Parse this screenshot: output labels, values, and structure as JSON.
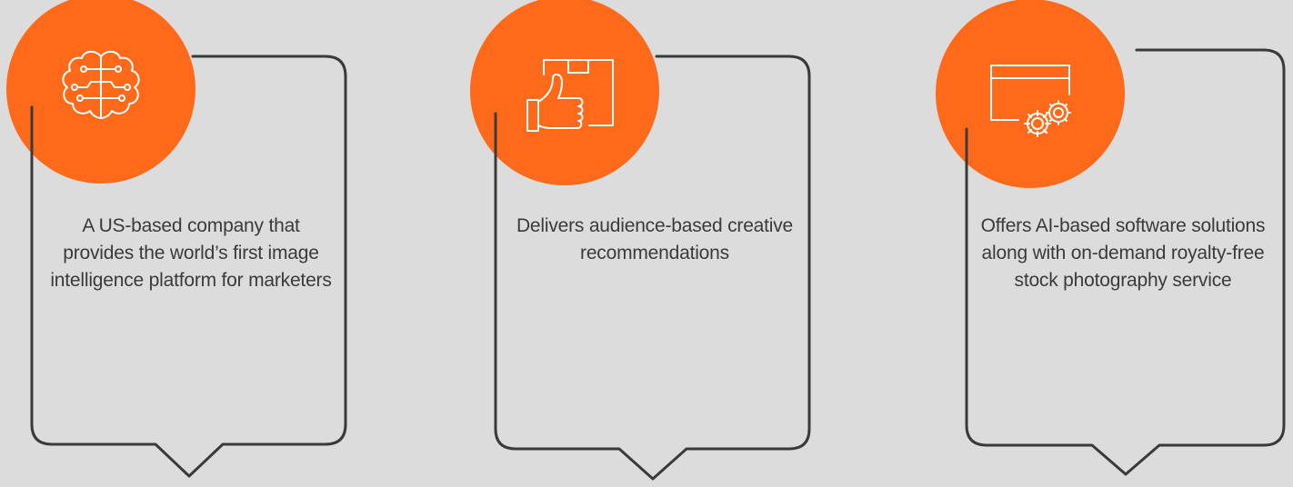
{
  "colors": {
    "background": "#DCDCDC",
    "accent": "#FF6A1A",
    "outline": "#3A3A3A",
    "text": "#3A3A3A",
    "icon": "#FFFFFF"
  },
  "cards": [
    {
      "icon": "brain-circuit-icon",
      "text": "A US-based company that provides the world’s first image intelligence platform for marketers"
    },
    {
      "icon": "thumbs-up-box-icon",
      "text": "Delivers audience-based creative recommendations"
    },
    {
      "icon": "window-gears-icon",
      "text": "Offers AI-based software solutions along with on-demand royalty-free stock photography service"
    }
  ]
}
